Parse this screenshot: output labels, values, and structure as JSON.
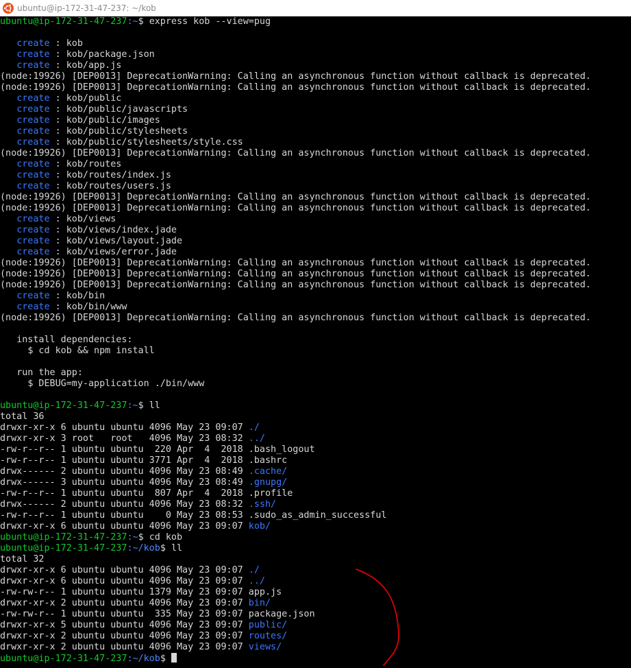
{
  "window": {
    "title": "ubuntu@ip-172-31-47-237: ~/kob"
  },
  "colors": {
    "prompt_user": "#13c82d",
    "prompt_path": "#4f87ff",
    "create_word": "#3b78ff",
    "directory": "#3b78ff",
    "text": "#d8d8d8",
    "background": "#000000",
    "annotation": "#e00000"
  },
  "prompt": {
    "user_host": "ubuntu@ip-172-31-47-237",
    "home_path": ":~",
    "kob_path": ":~/kob",
    "symbol": "$ "
  },
  "commands": {
    "express": "express kob --view=pug",
    "ll": "ll",
    "cd": "cd kob"
  },
  "create_label": "create",
  "sep": " : ",
  "deprecation": "(node:19926) [DEP0013] DeprecationWarning: Calling an asynchronous function without callback is deprecated.",
  "created_paths": [
    "kob",
    "kob/package.json",
    "kob/app.js",
    "kob/public",
    "kob/public/javascripts",
    "kob/public/images",
    "kob/public/stylesheets",
    "kob/public/stylesheets/style.css",
    "kob/routes",
    "kob/routes/index.js",
    "kob/routes/users.js",
    "kob/views",
    "kob/views/index.jade",
    "kob/views/layout.jade",
    "kob/views/error.jade",
    "kob/bin",
    "kob/bin/www"
  ],
  "instructions": {
    "install_heading": "install dependencies:",
    "install_cmd": "$ cd kob && npm install",
    "run_heading": "run the app:",
    "run_cmd": "$ DEBUG=my-application ./bin/www"
  },
  "listing_home": {
    "total": "total 36",
    "rows": [
      {
        "prefix": "drwxr-xr-x 6 ubuntu ubuntu 4096 May 23 09:07 ",
        "name": "./",
        "dir": true
      },
      {
        "prefix": "drwxr-xr-x 3 root   root   4096 May 23 08:32 ",
        "name": "../",
        "dir": true
      },
      {
        "prefix": "-rw-r--r-- 1 ubuntu ubuntu  220 Apr  4  2018 ",
        "name": ".bash_logout",
        "dir": false
      },
      {
        "prefix": "-rw-r--r-- 1 ubuntu ubuntu 3771 Apr  4  2018 ",
        "name": ".bashrc",
        "dir": false
      },
      {
        "prefix": "drwx------ 2 ubuntu ubuntu 4096 May 23 08:49 ",
        "name": ".cache/",
        "dir": true
      },
      {
        "prefix": "drwx------ 3 ubuntu ubuntu 4096 May 23 08:49 ",
        "name": ".gnupg/",
        "dir": true
      },
      {
        "prefix": "-rw-r--r-- 1 ubuntu ubuntu  807 Apr  4  2018 ",
        "name": ".profile",
        "dir": false
      },
      {
        "prefix": "drwx------ 2 ubuntu ubuntu 4096 May 23 08:32 ",
        "name": ".ssh/",
        "dir": true
      },
      {
        "prefix": "-rw-r--r-- 1 ubuntu ubuntu    0 May 23 08:53 ",
        "name": ".sudo_as_admin_successful",
        "dir": false
      },
      {
        "prefix": "drwxr-xr-x 6 ubuntu ubuntu 4096 May 23 09:07 ",
        "name": "kob/",
        "dir": true
      }
    ]
  },
  "listing_kob": {
    "total": "total 32",
    "rows": [
      {
        "prefix": "drwxr-xr-x 6 ubuntu ubuntu 4096 May 23 09:07 ",
        "name": "./",
        "dir": true
      },
      {
        "prefix": "drwxr-xr-x 6 ubuntu ubuntu 4096 May 23 09:07 ",
        "name": "../",
        "dir": true
      },
      {
        "prefix": "-rw-rw-r-- 1 ubuntu ubuntu 1379 May 23 09:07 ",
        "name": "app.js",
        "dir": false
      },
      {
        "prefix": "drwxr-xr-x 2 ubuntu ubuntu 4096 May 23 09:07 ",
        "name": "bin/",
        "dir": true
      },
      {
        "prefix": "-rw-rw-r-- 1 ubuntu ubuntu  335 May 23 09:07 ",
        "name": "package.json",
        "dir": false
      },
      {
        "prefix": "drwxr-xr-x 5 ubuntu ubuntu 4096 May 23 09:07 ",
        "name": "public/",
        "dir": true
      },
      {
        "prefix": "drwxr-xr-x 2 ubuntu ubuntu 4096 May 23 09:07 ",
        "name": "routes/",
        "dir": true
      },
      {
        "prefix": "drwxr-xr-x 2 ubuntu ubuntu 4096 May 23 09:07 ",
        "name": "views/",
        "dir": true
      }
    ]
  },
  "sequence": [
    {
      "t": "prompt",
      "path": "home",
      "cmd": "express"
    },
    {
      "t": "blank"
    },
    {
      "t": "create",
      "i": 0
    },
    {
      "t": "create",
      "i": 1
    },
    {
      "t": "create",
      "i": 2
    },
    {
      "t": "dep"
    },
    {
      "t": "dep"
    },
    {
      "t": "create",
      "i": 3
    },
    {
      "t": "create",
      "i": 4
    },
    {
      "t": "create",
      "i": 5
    },
    {
      "t": "create",
      "i": 6
    },
    {
      "t": "create",
      "i": 7
    },
    {
      "t": "dep"
    },
    {
      "t": "create",
      "i": 8
    },
    {
      "t": "create",
      "i": 9
    },
    {
      "t": "create",
      "i": 10
    },
    {
      "t": "dep"
    },
    {
      "t": "dep"
    },
    {
      "t": "create",
      "i": 11
    },
    {
      "t": "create",
      "i": 12
    },
    {
      "t": "create",
      "i": 13
    },
    {
      "t": "create",
      "i": 14
    },
    {
      "t": "dep"
    },
    {
      "t": "dep"
    },
    {
      "t": "dep"
    },
    {
      "t": "create",
      "i": 15
    },
    {
      "t": "create",
      "i": 16
    },
    {
      "t": "dep"
    },
    {
      "t": "blank"
    },
    {
      "t": "text",
      "indent": "   ",
      "key": "install_heading"
    },
    {
      "t": "text",
      "indent": "     ",
      "key": "install_cmd"
    },
    {
      "t": "blank"
    },
    {
      "t": "text",
      "indent": "   ",
      "key": "run_heading"
    },
    {
      "t": "text",
      "indent": "     ",
      "key": "run_cmd"
    },
    {
      "t": "blank"
    },
    {
      "t": "prompt",
      "path": "home",
      "cmd": "ll"
    },
    {
      "t": "listing",
      "which": "listing_home"
    },
    {
      "t": "prompt",
      "path": "home",
      "cmd": "cd"
    },
    {
      "t": "prompt",
      "path": "kob",
      "cmd": "ll"
    },
    {
      "t": "listing",
      "which": "listing_kob"
    },
    {
      "t": "prompt",
      "path": "kob",
      "cmd": null,
      "cursor": true
    }
  ]
}
